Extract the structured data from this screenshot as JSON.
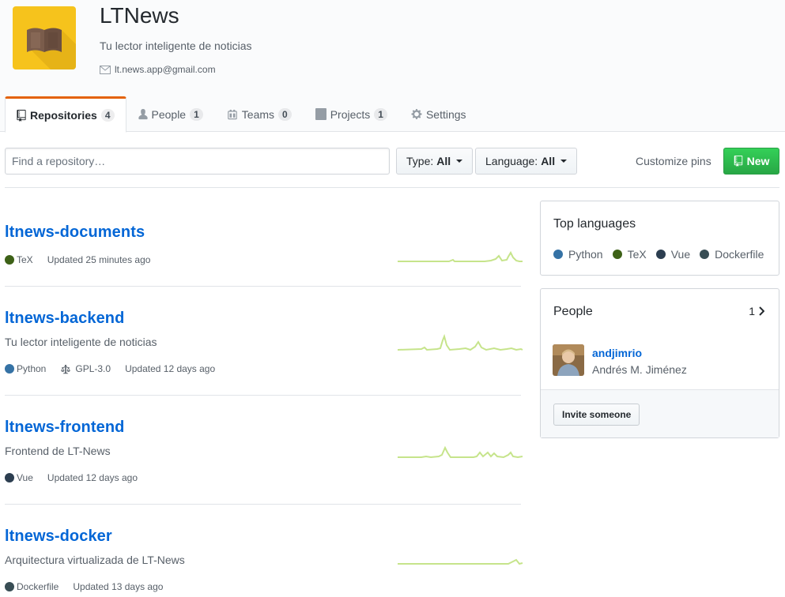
{
  "org": {
    "name": "LTNews",
    "description": "Tu lector inteligente de noticias",
    "email": "lt.news.app@gmail.com",
    "logo_icon": "book-icon",
    "logo_color": "#f6c31c"
  },
  "tabs": [
    {
      "label": "Repositories",
      "count": "4",
      "icon": "repo-icon",
      "active": true
    },
    {
      "label": "People",
      "count": "1",
      "icon": "person-icon"
    },
    {
      "label": "Teams",
      "count": "0",
      "icon": "team-icon"
    },
    {
      "label": "Projects",
      "count": "1",
      "icon": "project-icon"
    },
    {
      "label": "Settings",
      "icon": "gear-icon"
    }
  ],
  "filters": {
    "search_placeholder": "Find a repository…",
    "type_label": "Type:",
    "type_value": "All",
    "language_label": "Language:",
    "language_value": "All",
    "customize_label": "Customize pins",
    "new_label": "New"
  },
  "repos": [
    {
      "name": "ltnews-documents",
      "description": "",
      "language": "TeX",
      "language_color": "#3d6117",
      "license": "",
      "updated": "Updated 25 minutes ago"
    },
    {
      "name": "ltnews-backend",
      "description": "Tu lector inteligente de noticias",
      "language": "Python",
      "language_color": "#3572A5",
      "license": "GPL-3.0",
      "updated": "Updated 12 days ago"
    },
    {
      "name": "ltnews-frontend",
      "description": "Frontend de LT-News",
      "language": "Vue",
      "language_color": "#2c3e50",
      "license": "",
      "updated": "Updated 12 days ago"
    },
    {
      "name": "ltnews-docker",
      "description": "Arquitectura virtualizada de LT-News",
      "language": "Dockerfile",
      "language_color": "#384d54",
      "license": "",
      "updated": "Updated 13 days ago"
    }
  ],
  "sidebar": {
    "top_languages_title": "Top languages",
    "languages": [
      {
        "name": "Python",
        "color": "#3572A5"
      },
      {
        "name": "TeX",
        "color": "#3d6117"
      },
      {
        "name": "Vue",
        "color": "#2c3e50"
      },
      {
        "name": "Dockerfile",
        "color": "#384d54"
      }
    ],
    "people_title": "People",
    "people_count": "1",
    "person_login": "andjimrio",
    "person_name": "Andrés M. Jiménez",
    "invite_label": "Invite someone"
  }
}
